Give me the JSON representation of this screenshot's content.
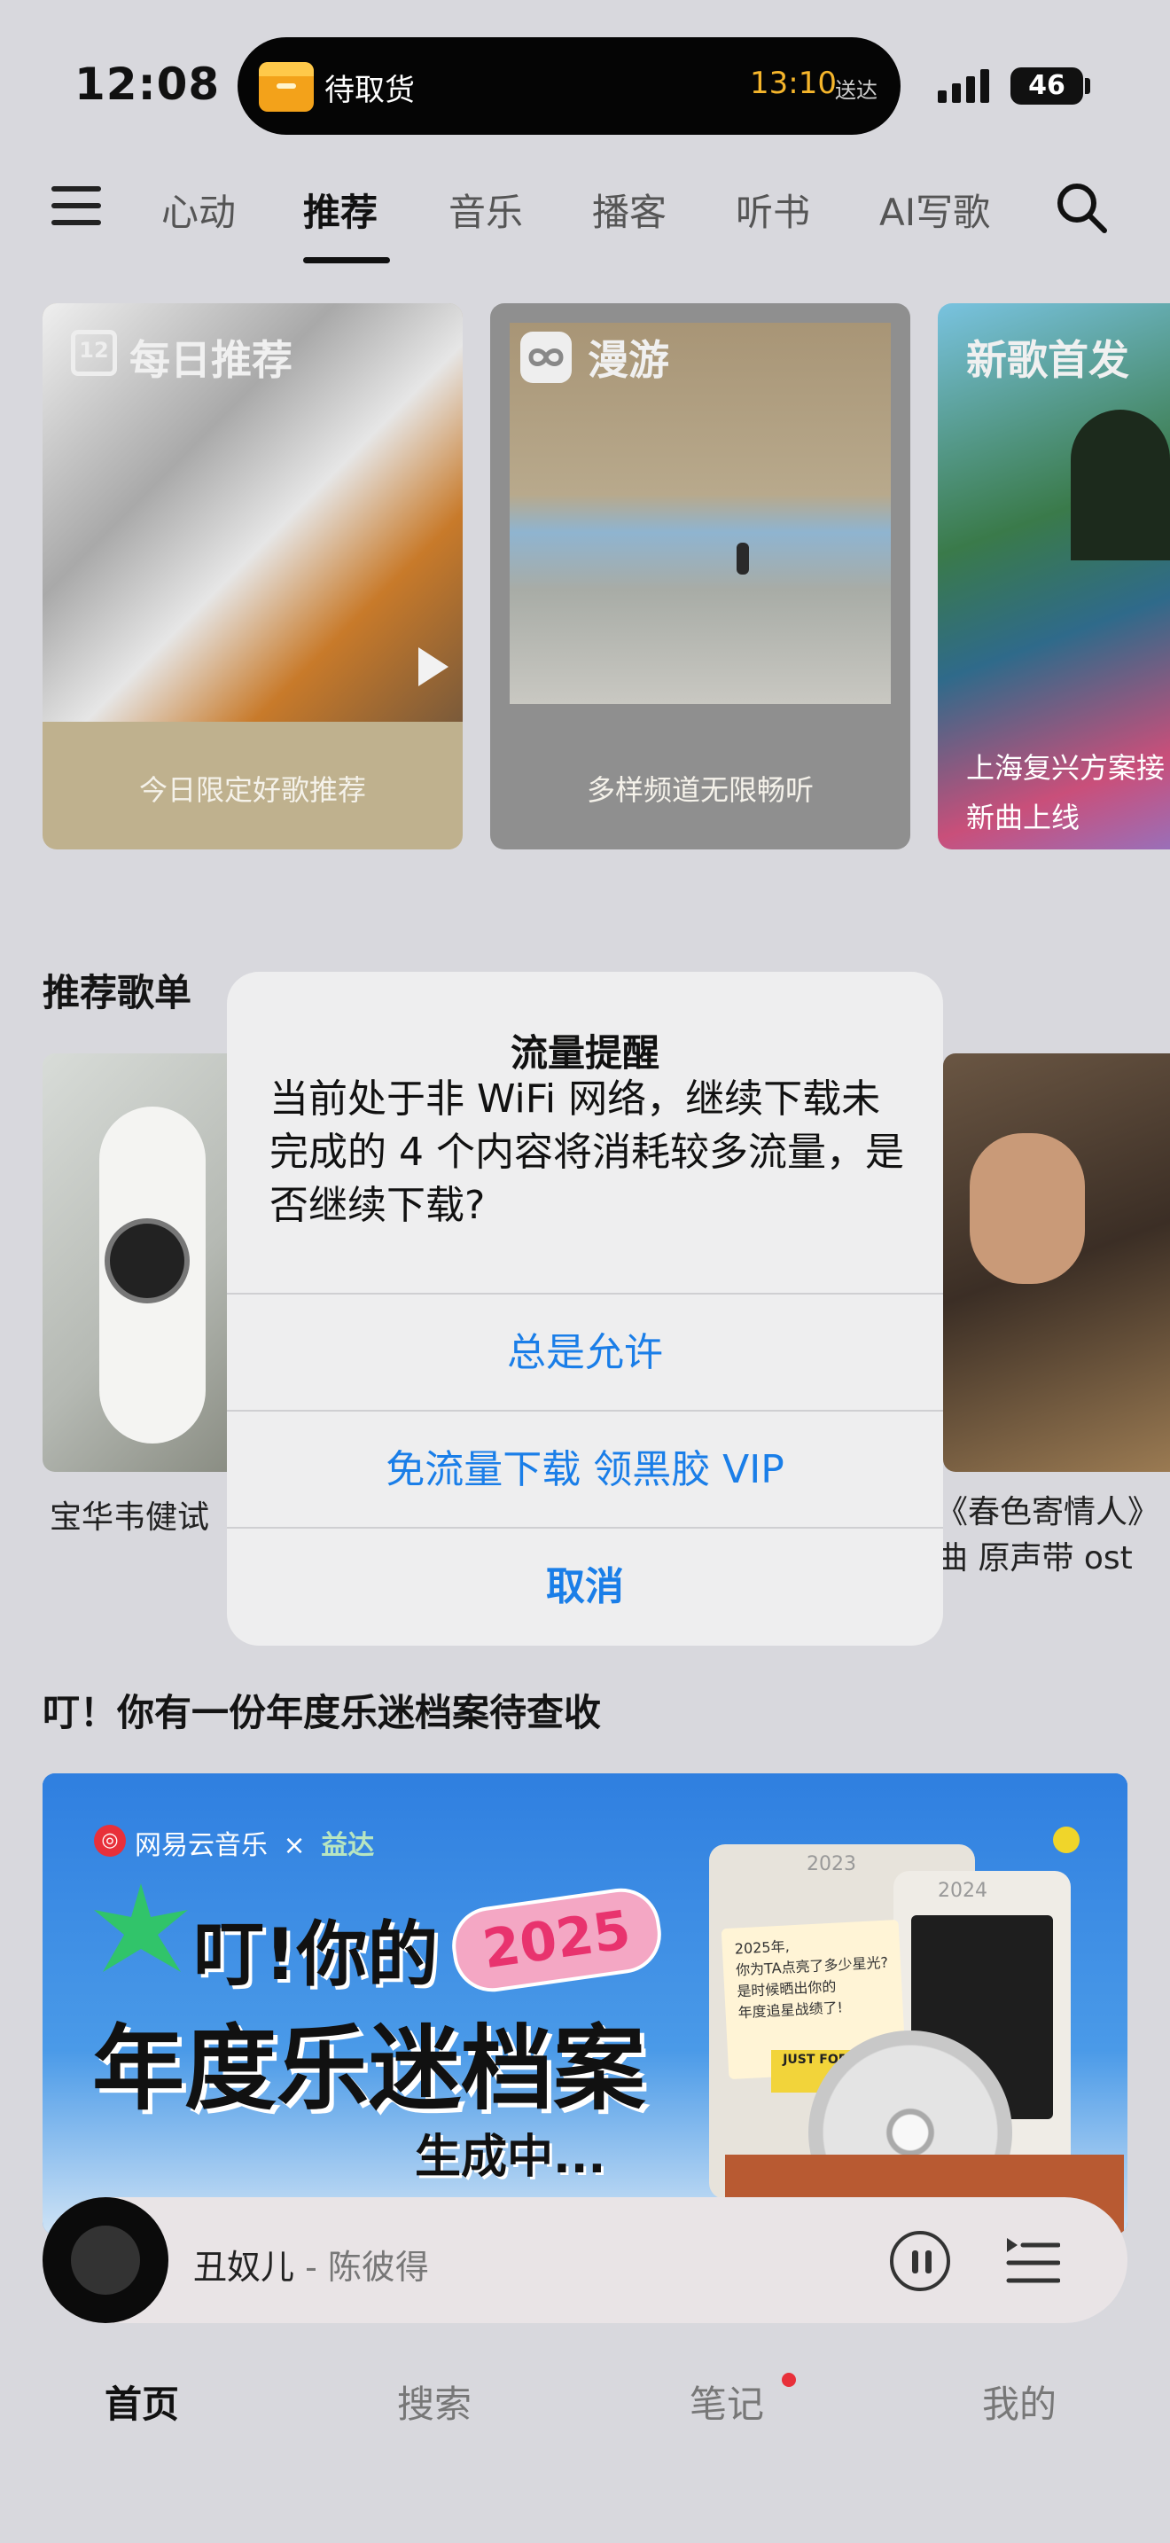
{
  "status_bar": {
    "time": "12:08",
    "live_activity": "待取货",
    "eta_time": "13:10",
    "eta_suffix": "送达",
    "battery": "46"
  },
  "nav": {
    "tabs": [
      "心动",
      "推荐",
      "音乐",
      "播客",
      "听书",
      "AI写歌"
    ],
    "active_tab": "推荐"
  },
  "cards": [
    {
      "title": "每日推荐",
      "icon_text": "12",
      "subtitle": "今日限定好歌推荐"
    },
    {
      "title": "漫游",
      "subtitle": "多样频道无限畅听"
    },
    {
      "title": "新歌首发",
      "subtitle_lines": [
        "上海复兴方案接",
        "新曲上线"
      ]
    }
  ],
  "section_playlist": {
    "title": "推荐歌单",
    "left_caption": "宝华韦健试",
    "right_caption_lines": [
      "《春色寄情人》",
      "曲 原声带 ost"
    ]
  },
  "dialog": {
    "title": "流量提醒",
    "message": "当前处于非 WiFi 网络，继续下载未完成的 4 个内容将消耗较多流量，是否继续下载?",
    "buttons": [
      "总是允许",
      "免流量下载 领黑胶 VIP",
      "取消"
    ]
  },
  "section_archive": {
    "title": "叮！你有一份年度乐迷档案待查收"
  },
  "banner": {
    "brand": "网易云音乐",
    "times": "×",
    "partner": "益达",
    "line1": "叮!你的",
    "year": "2025",
    "line2": "年度乐迷档案",
    "line3": "生成中...",
    "note_lines": [
      "2025年,",
      "你为TA点亮了多少星光?",
      "是时候晒出你的",
      "年度追星战绩了!"
    ],
    "ticket": "JUST FOR U",
    "folder_year_1": "2023",
    "folder_year_2": "2024"
  },
  "player": {
    "song": "丑奴儿",
    "separator": " - ",
    "artist": "陈彼得"
  },
  "bottom_tabs": [
    "首页",
    "搜索",
    "笔记",
    "我的"
  ],
  "colors": {
    "accent": "#1a7ee8",
    "notification_dot": "#e8303a",
    "eta": "#f5b52b"
  }
}
